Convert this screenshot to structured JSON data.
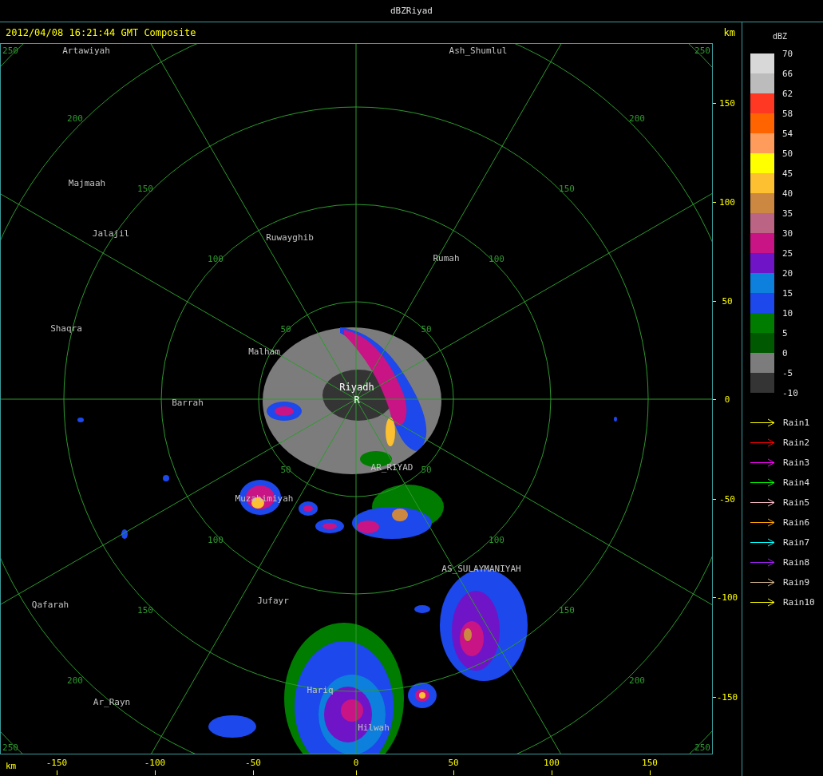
{
  "window": {
    "title": "dBZRiyad"
  },
  "header": {
    "timestamp": "2012/04/08 16:21:44 GMT Composite",
    "unit": "km"
  },
  "map": {
    "places": [
      {
        "name": "Artawiyah",
        "kind": "town"
      },
      {
        "name": "Ash_Shumlul",
        "kind": "town"
      },
      {
        "name": "Majmaah",
        "kind": "town"
      },
      {
        "name": "Jalajil",
        "kind": "town"
      },
      {
        "name": "Ruwayghib",
        "kind": "town"
      },
      {
        "name": "Rumah",
        "kind": "town"
      },
      {
        "name": "Shaqra",
        "kind": "town"
      },
      {
        "name": "Malham",
        "kind": "town"
      },
      {
        "name": "Riyadh",
        "kind": "radar_site"
      },
      {
        "name": "R",
        "kind": "radar_marker"
      },
      {
        "name": "Barrah",
        "kind": "town"
      },
      {
        "name": "AR_RIYAD",
        "kind": "town"
      },
      {
        "name": "Muzahimiyah",
        "kind": "town"
      },
      {
        "name": "AS_SULAYMANIYAH",
        "kind": "town"
      },
      {
        "name": "Jufayr",
        "kind": "town"
      },
      {
        "name": "Qafarah",
        "kind": "town"
      },
      {
        "name": "Hariq",
        "kind": "town"
      },
      {
        "name": "Ar_Rayn",
        "kind": "town"
      },
      {
        "name": "Hilwah",
        "kind": "town"
      }
    ],
    "range_rings": [
      {
        "labels": [
          "50",
          "50",
          "50",
          "50"
        ]
      },
      {
        "labels": [
          "100",
          "100",
          "100",
          "100"
        ]
      },
      {
        "labels": [
          "150",
          "150",
          "150",
          "150"
        ]
      },
      {
        "labels": [
          "200",
          "200",
          "200",
          "200"
        ]
      },
      {
        "labels": [
          "250",
          "250",
          "250",
          "250"
        ]
      }
    ]
  },
  "y_axis": {
    "ticks": [
      "150",
      "100",
      "50",
      "0",
      "-50",
      "-100",
      "-150"
    ]
  },
  "x_axis": {
    "unit": "km",
    "ticks": [
      "-150",
      "-100",
      "-50",
      "0",
      "50",
      "100",
      "150"
    ]
  },
  "legend": {
    "title": "dBZ",
    "color_scale": [
      {
        "color": "#d8d8d8"
      },
      {
        "color": "#bcbcbc"
      },
      {
        "color": "#ff3824"
      },
      {
        "color": "#ff6400"
      },
      {
        "color": "#ff9c5c"
      },
      {
        "color": "#ffff00"
      },
      {
        "color": "#fcc030"
      },
      {
        "color": "#cc8840"
      },
      {
        "color": "#bc6484"
      },
      {
        "color": "#c81484"
      },
      {
        "color": "#7014c8"
      },
      {
        "color": "#0c80dc"
      },
      {
        "color": "#1c48ec"
      },
      {
        "color": "#007c00"
      },
      {
        "color": "#005800"
      },
      {
        "color": "#7c7c7c"
      },
      {
        "color": "#343434"
      }
    ],
    "scale_labels": [
      "70",
      "66",
      "62",
      "58",
      "54",
      "50",
      "45",
      "40",
      "35",
      "30",
      "25",
      "20",
      "15",
      "10",
      "5",
      "0",
      "-5",
      "-10"
    ],
    "rain_tracks": [
      {
        "label": "Rain1",
        "color": "#ffff00"
      },
      {
        "label": "Rain2",
        "color": "#ff0000"
      },
      {
        "label": "Rain3",
        "color": "#ff00ff"
      },
      {
        "label": "Rain4",
        "color": "#00ff00"
      },
      {
        "label": "Rain5",
        "color": "#ffc0cb"
      },
      {
        "label": "Rain6",
        "color": "#ffa500"
      },
      {
        "label": "Rain7",
        "color": "#00ffff"
      },
      {
        "label": "Rain8",
        "color": "#a020f0"
      },
      {
        "label": "Rain9",
        "color": "#d2b48c"
      },
      {
        "label": "Rain10",
        "color": "#ffff00"
      }
    ]
  }
}
